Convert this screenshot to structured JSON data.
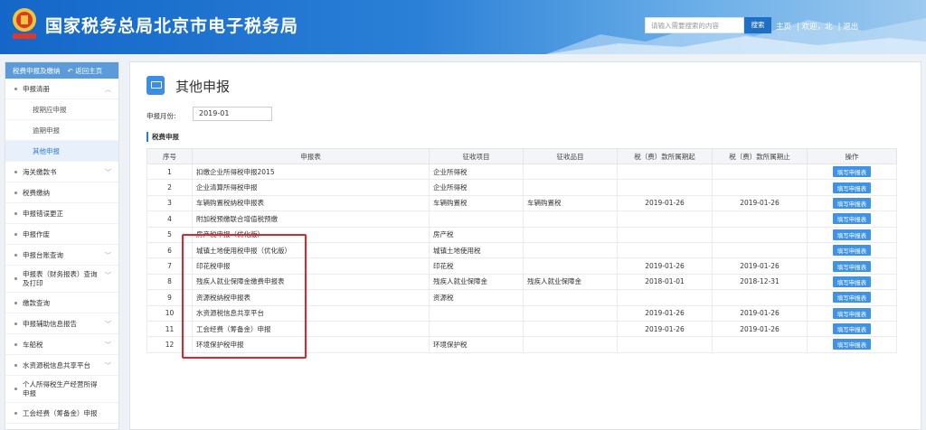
{
  "header": {
    "title": "国家税务总局北京市电子税务局",
    "search_placeholder": "请输入需要搜索的内容",
    "search_button": "搜索",
    "links": [
      "主页",
      "欢迎，北",
      "退出"
    ]
  },
  "sidebar": {
    "top_tab": "税费申报及缴纳",
    "back_link": "返回主页",
    "items": [
      {
        "label": "申报清册",
        "expandable": true
      },
      {
        "label": "按期应申报",
        "sub": true
      },
      {
        "label": "逾期申报",
        "sub": true
      },
      {
        "label": "其他申报",
        "sub": true,
        "active": true
      },
      {
        "label": "海关缴款书",
        "expandable": true
      },
      {
        "label": "税费缴纳"
      },
      {
        "label": "申报错误更正"
      },
      {
        "label": "申报作废"
      },
      {
        "label": "申报台账查询",
        "expandable": true
      },
      {
        "label": "申报表（财务报表）查询及打印",
        "expandable": true
      },
      {
        "label": "缴款查询"
      },
      {
        "label": "申报辅助信息报告",
        "expandable": true
      },
      {
        "label": "车船税",
        "expandable": true
      },
      {
        "label": "水资源税信息共享平台",
        "expandable": true
      },
      {
        "label": "个人所得税生产经营所得申报"
      },
      {
        "label": "工会经费（筹备金）申报"
      }
    ]
  },
  "main": {
    "title": "其他申报",
    "period_label": "申报月份:",
    "period_value": "2019-01",
    "section_title": "税费申报"
  },
  "table": {
    "headers": [
      "序号",
      "申报表",
      "征收项目",
      "征收品目",
      "税（费）款所属期起",
      "税（费）款所属期止",
      "操作"
    ],
    "button_label": "填写申报表",
    "rows": [
      [
        "1",
        "扣缴企业所得税申报2015",
        "企业所得税",
        "",
        "",
        ""
      ],
      [
        "2",
        "企业清算所得税申报",
        "企业所得税",
        "",
        "",
        ""
      ],
      [
        "3",
        "车辆购置税纳税申报表",
        "车辆购置税",
        "车辆购置税",
        "2019-01-26",
        "2019-01-26"
      ],
      [
        "4",
        "附加税预缴联合增值税预缴",
        "",
        "",
        "",
        ""
      ],
      [
        "5",
        "房产税申报（优化版）",
        "房产税",
        "",
        "",
        ""
      ],
      [
        "6",
        "城镇土地使用税申报（优化版）",
        "城镇土地使用税",
        "",
        "",
        ""
      ],
      [
        "7",
        "印花税申报",
        "印花税",
        "",
        "2019-01-26",
        "2019-01-26"
      ],
      [
        "8",
        "残疾人就业保障金缴费申报表",
        "残疾人就业保障金",
        "残疾人就业保障金",
        "2018-01-01",
        "2018-12-31"
      ],
      [
        "9",
        "资源税纳税申报表",
        "资源税",
        "",
        "",
        ""
      ],
      [
        "10",
        "水资源税信息共享平台",
        "",
        "",
        "2019-01-26",
        "2019-01-26"
      ],
      [
        "11",
        "工会经费（筹备金）申报",
        "",
        "",
        "2019-01-26",
        "2019-01-26"
      ],
      [
        "12",
        "环境保护税申报",
        "环境保护税",
        "",
        "",
        ""
      ]
    ]
  }
}
